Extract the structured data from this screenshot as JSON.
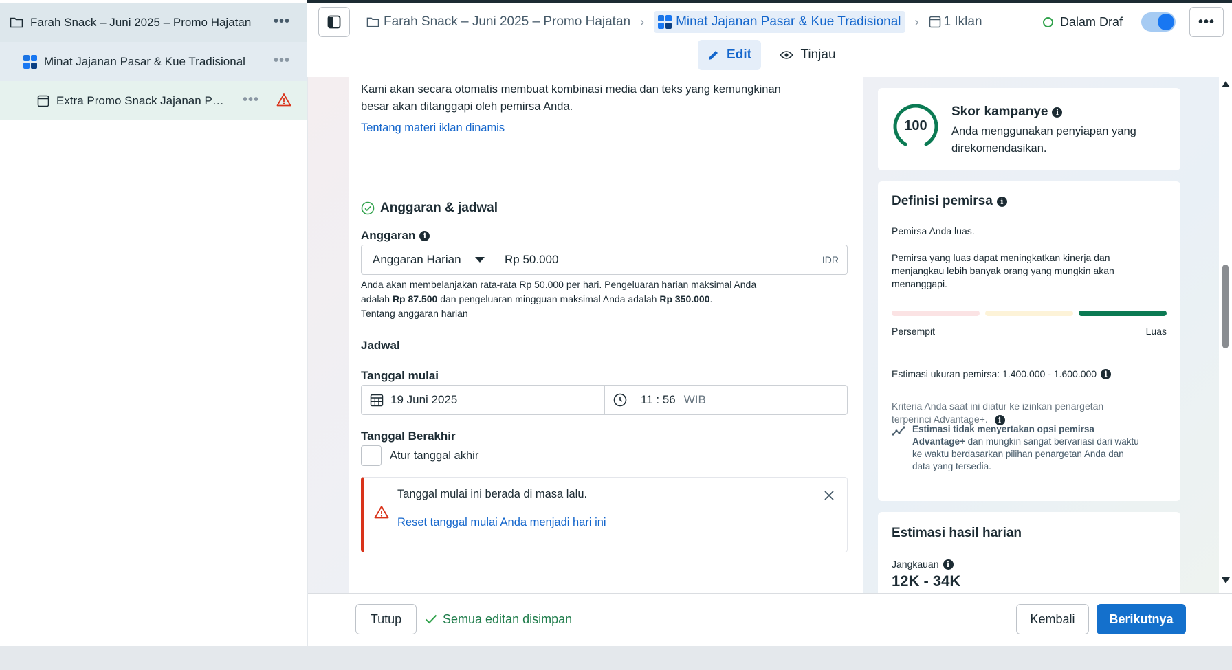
{
  "sidebar": {
    "campaign": "Farah Snack – Juni 2025 – Promo Hajatan",
    "adset": "Minat Jajanan Pasar & Kue Tradisional",
    "ad": "Extra Promo Snack Jajanan Pa..."
  },
  "topbar": {
    "crumb_campaign": "Farah Snack – Juni 2025 – Promo Hajatan",
    "crumb_adset": "Minat Jajanan Pasar & Kue Tradisional",
    "crumb_ads": "1 Iklan",
    "status": "Dalam Draf",
    "tab_edit": "Edit",
    "tab_review": "Tinjau"
  },
  "dynamic": {
    "text": "Kami akan secara otomatis membuat kombinasi media dan teks yang kemungkinan besar akan ditanggapi oleh pemirsa Anda.",
    "link": "Tentang materi iklan dinamis"
  },
  "budget": {
    "section_title": "Anggaran & jadwal",
    "budget_label": "Anggaran",
    "budget_type": "Anggaran Harian",
    "amount": "Rp 50.000",
    "currency": "IDR",
    "desc_1": "Anda akan membelanjakan rata-rata Rp 50.000 per hari. Pengeluaran harian maksimal Anda adalah ",
    "desc_max_daily": "Rp 87.500",
    "desc_2": " dan pengeluaran mingguan maksimal Anda adalah ",
    "desc_max_weekly": "Rp 350.000",
    "desc_3": ".",
    "link": "Tentang anggaran harian",
    "schedule_label": "Jadwal",
    "start_label": "Tanggal mulai",
    "start_date": "19 Juni 2025",
    "start_time": "11 : 56",
    "timezone": "WIB",
    "end_label": "Tanggal Berakhir",
    "end_checkbox": "Atur tanggal akhir",
    "alert_text": "Tanggal mulai ini berada di masa lalu.",
    "alert_link": "Reset tanggal mulai Anda menjadi hari ini"
  },
  "score": {
    "value": "100",
    "title": "Skor kampanye",
    "desc": "Anda menggunakan penyiapan yang direkomendasikan."
  },
  "audience": {
    "title": "Definisi pemirsa",
    "p1": "Pemirsa Anda luas.",
    "p2": "Pemirsa yang luas dapat meningkatkan kinerja dan menjangkau lebih banyak orang yang mungkin akan menanggapi.",
    "narrow": "Persempit",
    "broad": "Luas",
    "size": "Estimasi ukuran pemirsa: 1.400.000 - 1.600.000",
    "criteria": "Kriteria Anda saat ini diatur ke izinkan penargetan terperinci Advantage+.",
    "note_bold": "Estimasi tidak menyertakan opsi pemirsa Advantage+",
    "note_rest": " dan mungkin sangat bervariasi dari waktu ke waktu berdasarkan pilihan penargetan Anda dan data yang tersedia.",
    "level": "broad",
    "colors": {
      "narrow": "#fbe3e4",
      "mid": "#fdf3d8",
      "broad": "#0b7a53"
    }
  },
  "results": {
    "title": "Estimasi hasil harian",
    "reach_label": "Jangkauan",
    "reach_value": "12K - 34K"
  },
  "footer": {
    "close": "Tutup",
    "saved": "Semua editan disimpan",
    "back": "Kembali",
    "next": "Berikutnya"
  },
  "colors": {
    "accent": "#1470cc",
    "success": "#31a24c",
    "error": "#d9331a"
  }
}
